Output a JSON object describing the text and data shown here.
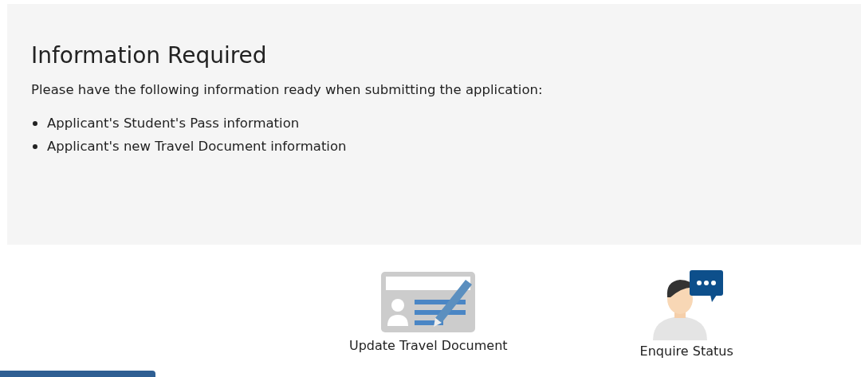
{
  "info_panel": {
    "title": "Information Required",
    "intro": "Please have the following information ready when submitting the application:",
    "items": [
      "Applicant's Student's Pass information",
      "Applicant's new Travel Document information"
    ]
  },
  "actions": [
    {
      "kind": "document",
      "label": "Update Travel Document"
    },
    {
      "kind": "enquire",
      "label": "Enquire Status"
    }
  ]
}
